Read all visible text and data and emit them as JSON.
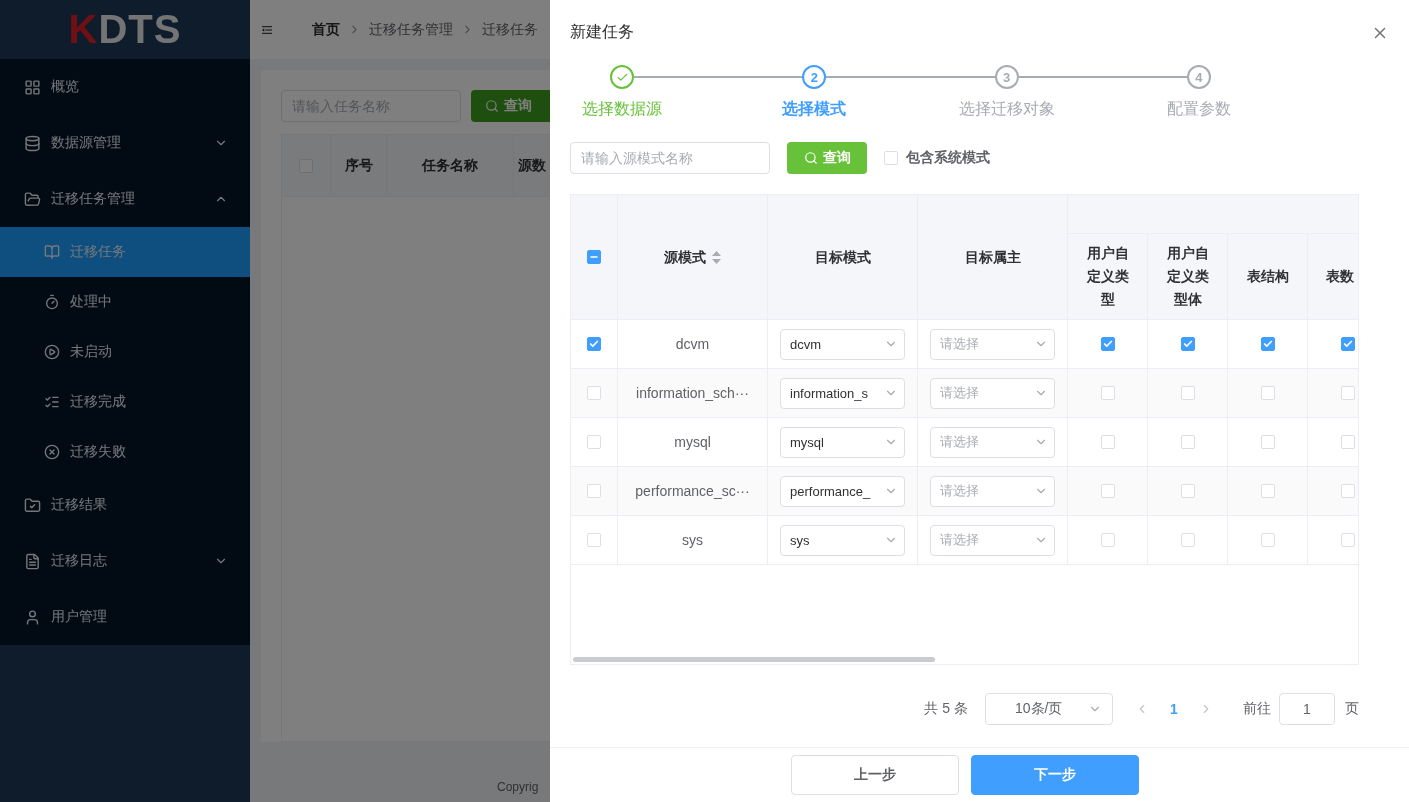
{
  "sidebar": {
    "logo": {
      "mark": "K",
      "text": "DTS"
    },
    "items": [
      {
        "label": "概览"
      },
      {
        "label": "数据源管理",
        "expanded": false
      },
      {
        "label": "迁移任务管理",
        "expanded": true,
        "children": [
          {
            "label": "迁移任务",
            "selected": true
          },
          {
            "label": "处理中",
            "selected": false
          },
          {
            "label": "未启动",
            "selected": false
          },
          {
            "label": "迁移完成",
            "selected": false
          },
          {
            "label": "迁移失败",
            "selected": false
          }
        ]
      },
      {
        "label": "迁移结果"
      },
      {
        "label": "迁移日志",
        "expanded": false
      },
      {
        "label": "用户管理"
      }
    ]
  },
  "header": {
    "breadcrumb": [
      "首页",
      "迁移任务管理",
      "迁移任务"
    ]
  },
  "task_list": {
    "search": {
      "placeholder": "请输入任务名称"
    },
    "search_button": "查询",
    "all_checked": false,
    "columns": [
      "序号",
      "任务名称",
      "源数"
    ],
    "footer": "Copyrig"
  },
  "drawer": {
    "title": "新建任务",
    "steps": [
      {
        "label": "选择数据源",
        "done": true,
        "selected": false
      },
      {
        "label": "选择模式",
        "number": "2",
        "done": false,
        "selected": true
      },
      {
        "label": "选择迁移对象",
        "number": "3",
        "done": false,
        "selected": false
      },
      {
        "label": "配置参数",
        "number": "4",
        "done": false,
        "selected": false
      }
    ],
    "search": {
      "placeholder": "请输入源模式名称"
    },
    "search_button": "查询",
    "include_system": {
      "label": "包含系统模式",
      "checked": false
    },
    "table": {
      "all_indeterminate": true,
      "columns": [
        {
          "label": "源模式",
          "sortable": true
        },
        {
          "label": "目标模式",
          "sortable": false
        },
        {
          "label": "目标属主",
          "sortable": false
        }
      ],
      "option_columns": [
        "用户自定义类型",
        "用户自定义类型体",
        "表结构",
        "表数"
      ],
      "rows": [
        {
          "checked": true,
          "source": "dcvm",
          "target": "dcvm",
          "owner": {
            "placeholder": "请选择"
          },
          "options": [
            true,
            true,
            true,
            true
          ]
        },
        {
          "checked": false,
          "source": "information_sch···",
          "target": "information_s",
          "owner": {
            "placeholder": "请选择"
          },
          "options": [
            false,
            false,
            false,
            false
          ]
        },
        {
          "checked": false,
          "source": "mysql",
          "target": "mysql",
          "owner": {
            "placeholder": "请选择"
          },
          "options": [
            false,
            false,
            false,
            false
          ]
        },
        {
          "checked": false,
          "source": "performance_sc···",
          "target": "performance_",
          "owner": {
            "placeholder": "请选择"
          },
          "options": [
            false,
            false,
            false,
            false
          ]
        },
        {
          "checked": false,
          "source": "sys",
          "target": "sys",
          "owner": {
            "placeholder": "请选择"
          },
          "options": [
            false,
            false,
            false,
            false
          ]
        }
      ]
    },
    "pagination": {
      "total": "共 5 条",
      "page_size": "10条/页",
      "pages": [
        {
          "label": "1",
          "selected": true
        }
      ],
      "goto_label": "前往",
      "goto_value": "1",
      "goto_suffix": "页"
    },
    "buttons": [
      {
        "label": "上一步",
        "kind": "default"
      },
      {
        "label": "下一步",
        "kind": "primary"
      }
    ]
  }
}
